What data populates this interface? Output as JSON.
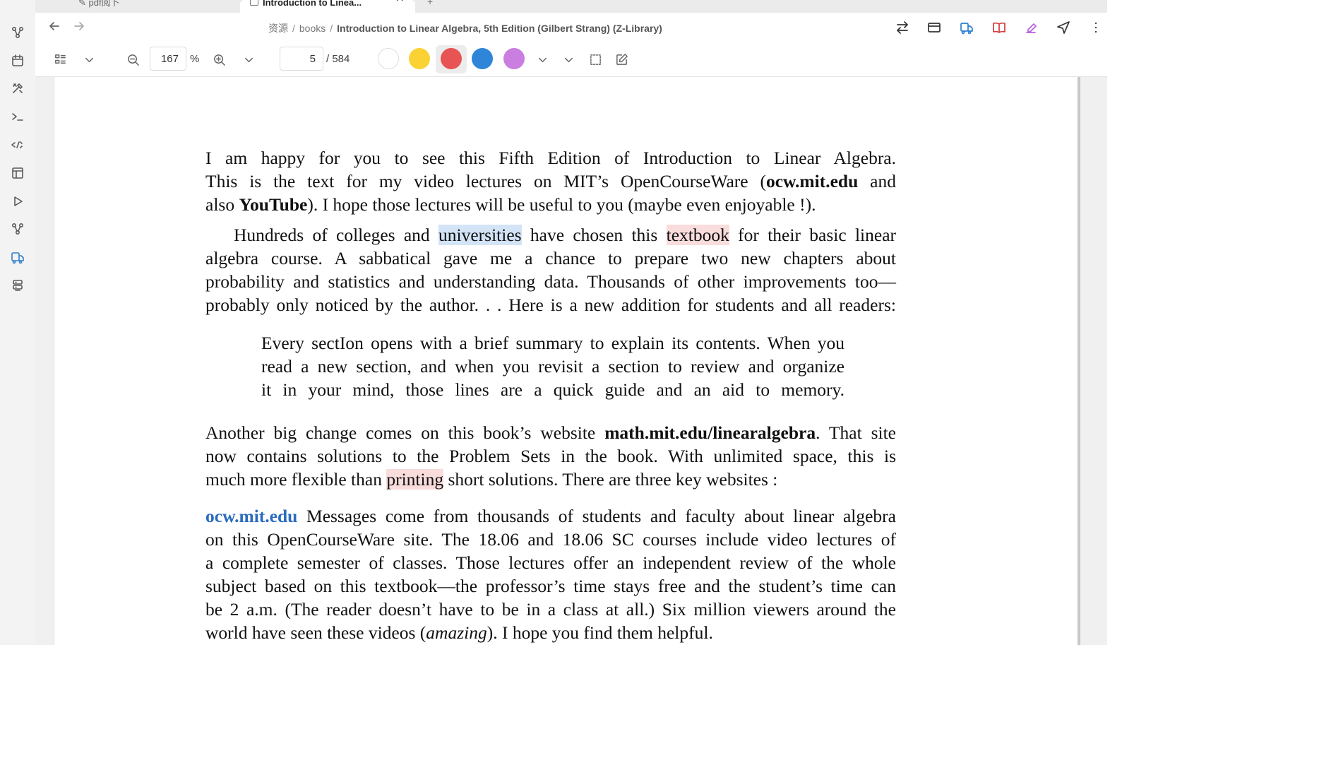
{
  "tabs": [
    {
      "label": "pdf阅卜",
      "active": false
    },
    {
      "label": "Introduction to Linea...",
      "active": true
    }
  ],
  "breadcrumb": {
    "items": [
      "资源",
      "books"
    ],
    "current": "Introduction to Linear Algebra, 5th Edition (Gilbert Strang) (Z-Library)"
  },
  "toolbar": {
    "zoom_value": "167",
    "zoom_unit": "%",
    "page_value": "5",
    "page_total": "/ 584",
    "highlight_colors": [
      "#ffffff",
      "#fbd233",
      "#e85454",
      "#2f86d8",
      "#c97ee0"
    ],
    "selected_color_index": 2
  },
  "ribbon": {
    "icons": [
      "graph-icon",
      "calendar-icon",
      "tools-icon",
      "terminal-icon",
      "template-icon",
      "layout-icon",
      "play-icon",
      "graph-icon-2",
      "pdf-icon",
      "database-icon"
    ]
  },
  "document": {
    "para1": {
      "l1": "I am happy for you to see this Fifth Edition of Introduction to Linear Algebra.",
      "l2a": "This is the text for my video lectures on MIT’s OpenCourseWare (",
      "l2b": "ocw.mit.edu",
      "l2c": " and",
      "l3a": "also ",
      "l3b": "YouTube",
      "l3c": ").  I hope those  lectures will be useful to you  (maybe even enjoyable !)."
    },
    "para2": {
      "l1a": "Hundreds of colleges and ",
      "l1b": "universities",
      "l1c": " have chosen this ",
      "l1d": "textbook",
      "l1e": " for their basic linear",
      "l2": "algebra course.  A sabbatical gave me a chance to prepare two new chapters about",
      "l3": "probability and statistics and understanding data. Thousands of other improvements too—",
      "l4": "probably only noticed by the author. . .  Here is a new addition for students and all readers:"
    },
    "quote": {
      "l1a": "Every sect",
      "l1b": "on opens with a brief summary to explain its contents. When you",
      "l2": "read a new section, and when you revisit a section to review and organize",
      "l3": "it in your mind, those lines are a quick guide and an aid to memory."
    },
    "para3": {
      "l1a": "Another big change comes on this book’s website ",
      "l1b": "math.mit.edu/linearalgebra",
      "l1c": ". That site",
      "l2": "now contains solutions to the Problem Sets in the book.  With unlimited space, this is",
      "l3a": "much more flexible than ",
      "l3b": "printing",
      "l3c": " short solutions. There are three key websites :"
    },
    "para4": {
      "l1a": "ocw.mit.edu",
      "l1b": " Messages come from thousands of students and faculty about linear algebra",
      "l2": "on this OpenCourseWare site.  The 18.06 and 18.06 SC courses include video lectures of",
      "l3": "a complete semester of classes.  Those lectures offer an independent review of the whole",
      "l4": "subject based on this textbook—the professor’s time stays free and the student’s time can",
      "l5": "be 2 a.m.  (The reader doesn’t have to be in a class at all.)  Six million viewers around the",
      "l6a": "world have seen these videos (",
      "l6b": "amazing",
      "l6c": "). I hope you find them helpful."
    }
  }
}
